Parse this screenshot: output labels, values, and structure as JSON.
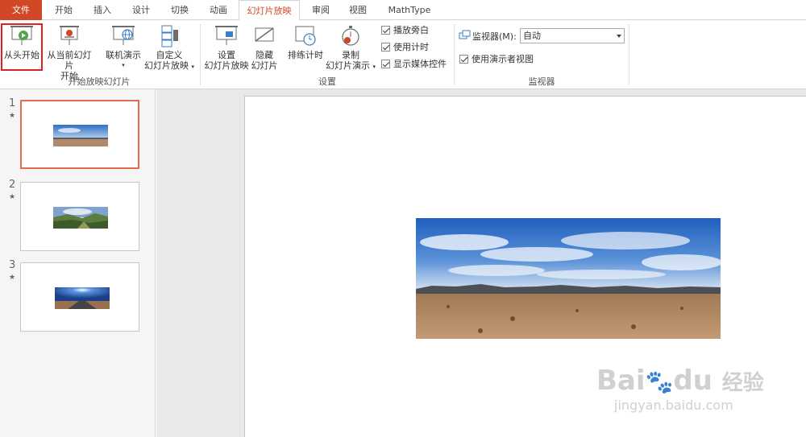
{
  "tabs": [
    "文件",
    "开始",
    "插入",
    "设计",
    "切换",
    "动画",
    "幻灯片放映",
    "审阅",
    "视图",
    "MathType"
  ],
  "active_tab_index": 6,
  "ribbon": {
    "group1": {
      "label": "开始放映幻灯片",
      "buttons": [
        {
          "label": "从头开始"
        },
        {
          "label1": "从当前幻灯片",
          "label2": "开始"
        },
        {
          "label": "联机演示"
        },
        {
          "label1": "自定义",
          "label2": "幻灯片放映"
        }
      ]
    },
    "group2": {
      "label": "设置",
      "buttons": [
        {
          "label1": "设置",
          "label2": "幻灯片放映"
        },
        {
          "label1": "隐藏",
          "label2": "幻灯片"
        },
        {
          "label": "排练计时"
        },
        {
          "label1": "录制",
          "label2": "幻灯片演示"
        }
      ],
      "checkboxes": [
        {
          "label": "播放旁白",
          "checked": true
        },
        {
          "label": "使用计时",
          "checked": true
        },
        {
          "label": "显示媒体控件",
          "checked": true
        }
      ]
    },
    "group3": {
      "label": "监视器",
      "monitor_label": "监视器(M):",
      "monitor_value": "自动",
      "presenter_view_label": "使用演示者视图",
      "presenter_view_checked": true
    }
  },
  "slides": [
    {
      "number": "1",
      "star": "★",
      "image": "desert-landscape"
    },
    {
      "number": "2",
      "star": "★",
      "image": "green-valley"
    },
    {
      "number": "3",
      "star": "★",
      "image": "road-sunrise"
    }
  ],
  "watermark": {
    "brand": "Bai",
    "brand2": "du",
    "cn": "经验",
    "url": "jingyan.baidu.com"
  },
  "colors": {
    "accent": "#d24726",
    "selection": "#e36c4a",
    "highlight": "#e02020"
  }
}
